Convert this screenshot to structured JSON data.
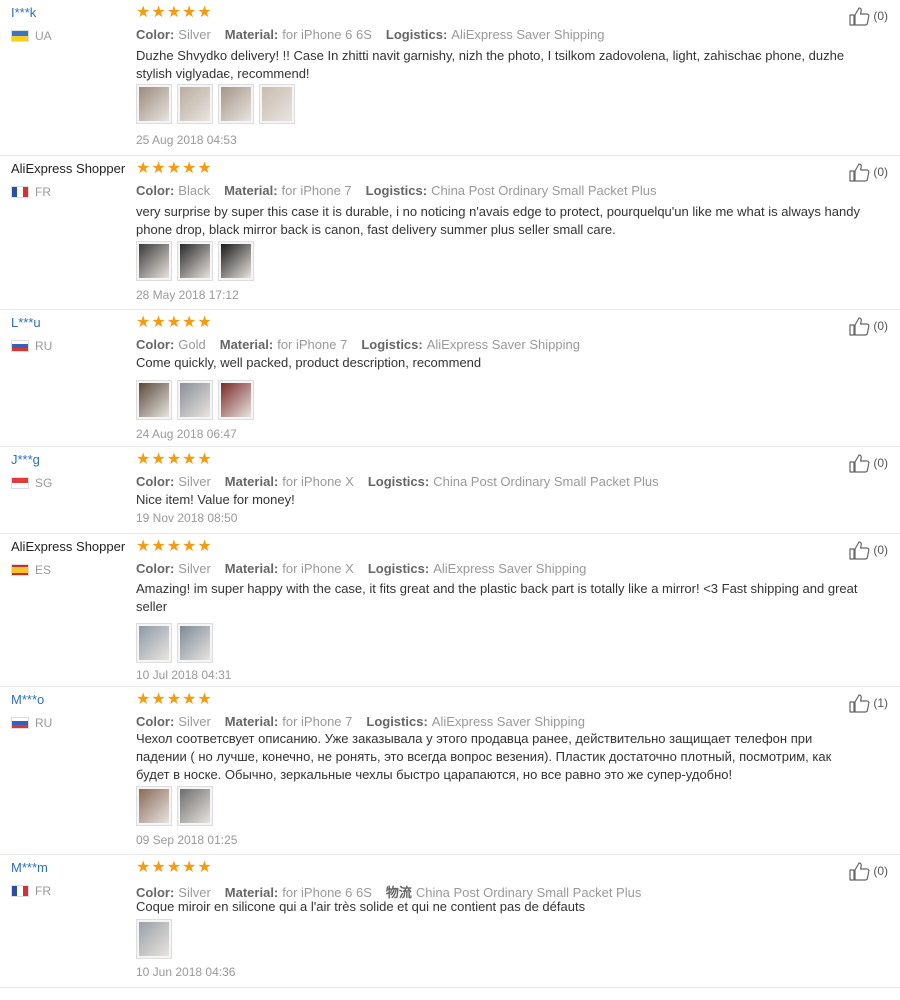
{
  "labels": {
    "color": "Color:",
    "material": "Material:",
    "logistics": "Logistics:"
  },
  "reviews": [
    {
      "user": "I***k",
      "masked": true,
      "flag": "ua",
      "country": "UA",
      "rating": 5,
      "color": "Silver",
      "material": "for iPhone 6 6S",
      "logistics_label": "Logistics:",
      "logistics": "AliExpress Saver Shipping",
      "text": "Duzhe Shvydko delivery! !! Case In zhitti navit garnishy, nizh the photo, I tsilkom zadovolena, light, zahischaє phone, duzhe stylish  viglyadaє, recommend!",
      "photos": [
        "#9a8b7e",
        "#b9ad9f",
        "#a4968a",
        "#c7bcb0"
      ],
      "date": "25 Aug 2018 04:53",
      "likes": "(0)"
    },
    {
      "user": "AliExpress Shopper",
      "masked": false,
      "flag": "fr",
      "country": "FR",
      "rating": 5,
      "color": "Black",
      "material": "for iPhone 7",
      "logistics_label": "Logistics:",
      "logistics": "China Post Ordinary Small Packet Plus",
      "text": "very surprise by super this case it is durable, i no noticing n'avais edge to protect, pourquelqu'un like me what is always handy phone drop, black mirror back is canon, fast delivery summer plus seller small care.",
      "photos": [
        "#3a3a3a",
        "#2a2a2a",
        "#1a1a1a"
      ],
      "date": "28 May 2018 17:12",
      "likes": "(0)"
    },
    {
      "user": "L***u",
      "masked": true,
      "flag": "ru",
      "country": "RU",
      "rating": 5,
      "color": "Gold",
      "material": "for iPhone 7",
      "logistics_label": "Logistics:",
      "logistics": "AliExpress Saver Shipping",
      "text": "Come quickly, well packed, product description, recommend",
      "photos": [
        "#5a4a3c",
        "#8b8f99",
        "#7a2a2a"
      ],
      "date": "24 Aug 2018 06:47",
      "likes": "(0)"
    },
    {
      "user": "J***g",
      "masked": true,
      "flag": "sg",
      "country": "SG",
      "rating": 5,
      "color": "Silver",
      "material": "for iPhone X",
      "logistics_label": "Logistics:",
      "logistics": "China Post Ordinary Small Packet Plus",
      "text": "Nice item! Value for money!",
      "photos": [],
      "date": "19 Nov 2018 08:50",
      "likes": "(0)"
    },
    {
      "user": "AliExpress Shopper",
      "masked": false,
      "flag": "es",
      "country": "ES",
      "rating": 5,
      "color": "Silver",
      "material": "for iPhone X",
      "logistics_label": "Logistics:",
      "logistics": "AliExpress Saver Shipping",
      "text": "Amazing! im super happy with the case, it fits great and the plastic back part is totally like a mirror! <3 Fast shipping and great seller",
      "photos": [
        "#8e9aa8",
        "#7d8a98"
      ],
      "date": "10 Jul 2018 04:31",
      "likes": "(0)"
    },
    {
      "user": "M***o",
      "masked": true,
      "flag": "ru",
      "country": "RU",
      "rating": 5,
      "color": "Silver",
      "material": "for iPhone 7",
      "logistics_label": "Logistics:",
      "logistics": "AliExpress Saver Shipping",
      "text": "Чехол соответсвует описанию. Уже заказывала у этого продавца ранее, действительно защищает телефон при падении ( но лучше, конечно, не ронять, это всегда вопрос везения). Пластик достаточно плотный, посмотрим, как будет в носке. Обычно, зеркальные чехлы быстро царапаются, но все равно это же супер-удобно!",
      "photos": [
        "#8a6a5a",
        "#6e6e6e"
      ],
      "date": "09 Sep 2018 01:25",
      "likes": "(1)"
    },
    {
      "user": "M***m",
      "masked": true,
      "flag": "fr",
      "country": "FR",
      "rating": 5,
      "color": "Silver",
      "material": "for iPhone 6 6S",
      "logistics_label": "物流",
      "logistics": "China Post Ordinary Small Packet Plus",
      "text": "Coque miroir en silicone qui a l'air très solide et qui ne contient pas de défauts",
      "photos": [
        "#9aa0a8"
      ],
      "date": "10 Jun 2018 04:36",
      "likes": "(0)"
    }
  ],
  "icons": {
    "star": "star-icon",
    "like": "thumbs-up-icon"
  },
  "colors": {
    "star": "#f39c12",
    "username": "#2f6fb6",
    "meta": "#999999"
  }
}
